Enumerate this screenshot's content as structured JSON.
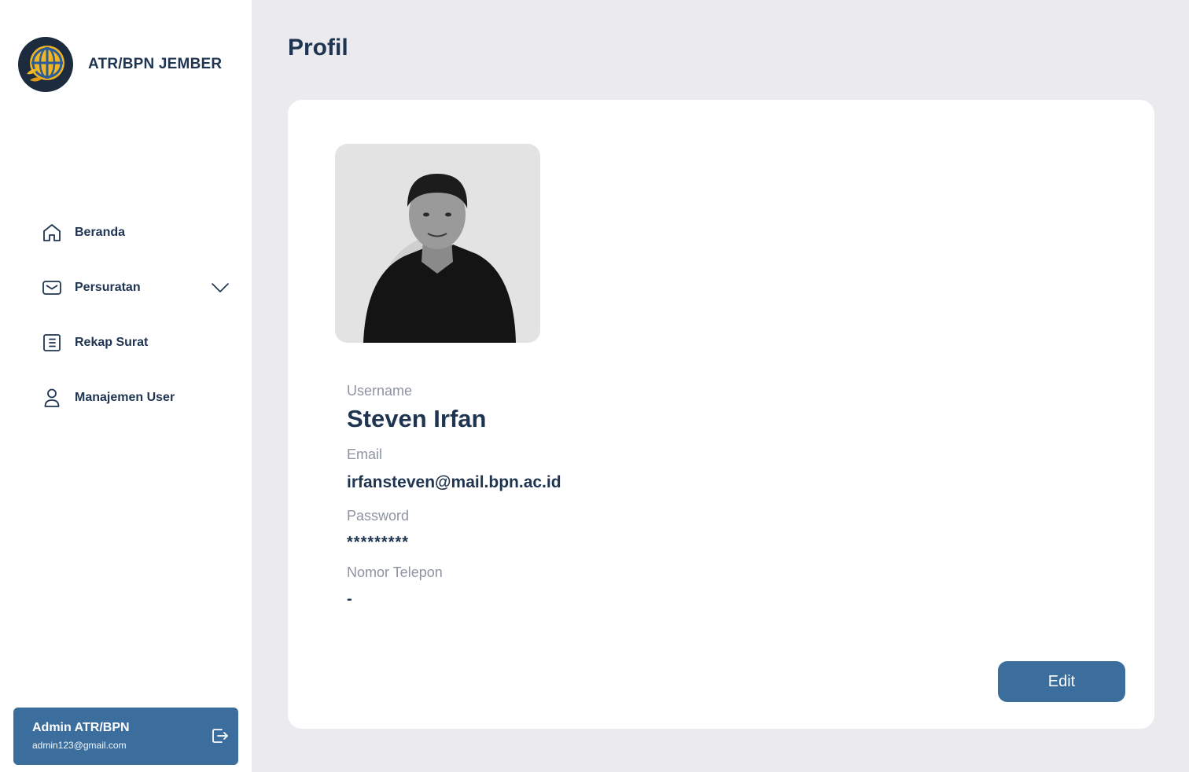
{
  "brand": {
    "name": "ATR/BPN JEMBER"
  },
  "nav": {
    "items": [
      {
        "label": "Beranda",
        "icon": "home-icon"
      },
      {
        "label": "Persuratan",
        "icon": "mail-icon",
        "expandable": true
      },
      {
        "label": "Rekap Surat",
        "icon": "document-list-icon"
      },
      {
        "label": "Manajemen User",
        "icon": "user-icon"
      }
    ]
  },
  "user": {
    "name": "Admin ATR/BPN",
    "email": "admin123@gmail.com"
  },
  "page": {
    "title": "Profil"
  },
  "profile": {
    "username_label": "Username",
    "username": "Steven Irfan",
    "email_label": "Email",
    "email": "irfansteven@mail.bpn.ac.id",
    "password_label": "Password",
    "password": "*********",
    "phone_label": "Nomor Telepon",
    "phone": "-",
    "edit_label": "Edit"
  },
  "colors": {
    "accent": "#3c6e9d",
    "text": "#1f3451",
    "muted": "#8d93a0",
    "background": "#ebebef"
  }
}
